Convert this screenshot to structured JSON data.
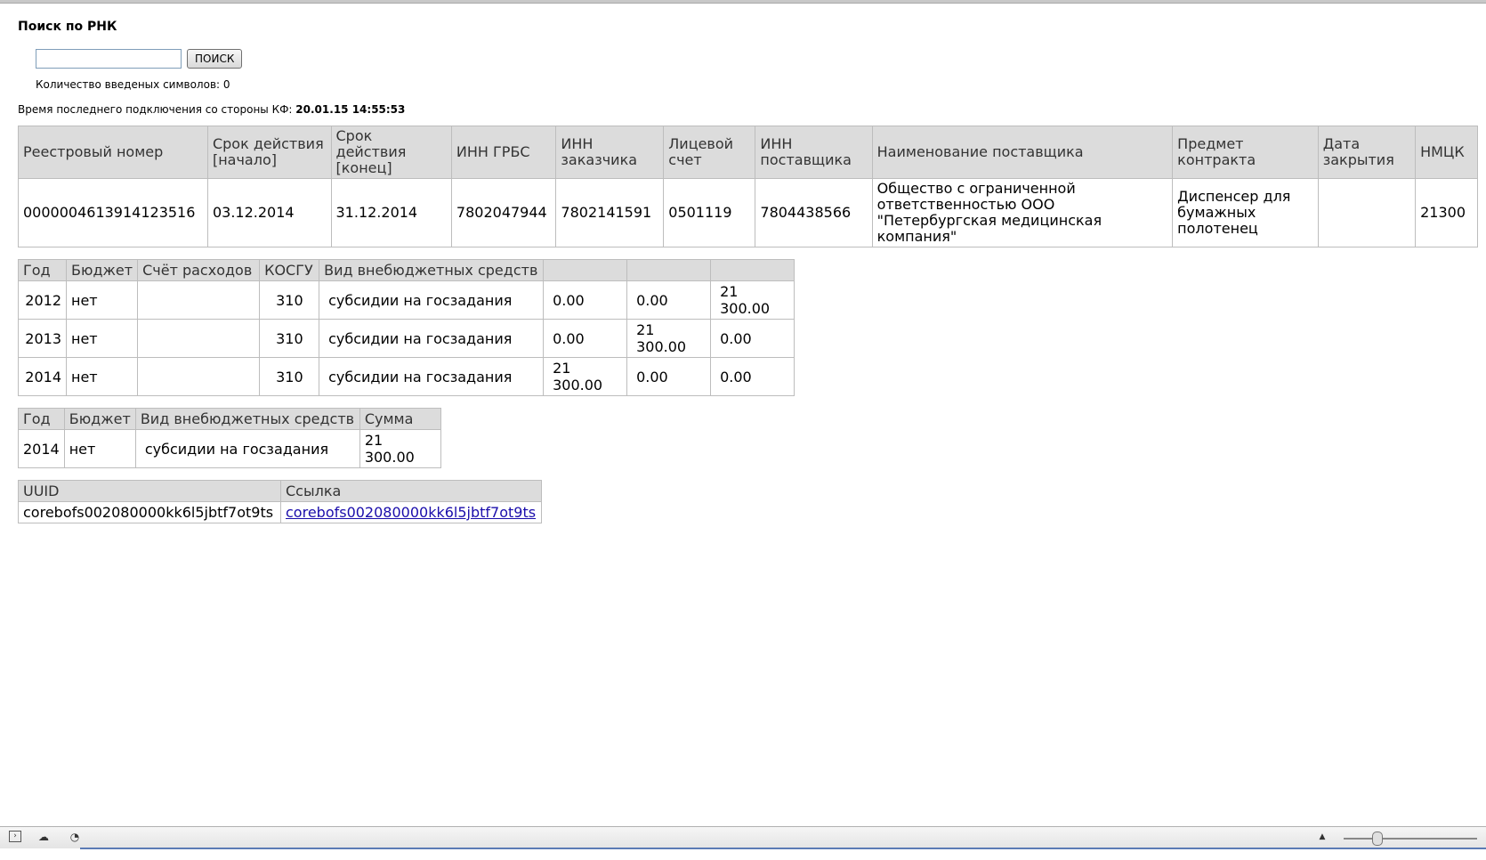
{
  "page": {
    "title": "Поиск по РНК",
    "search": {
      "placeholder": "",
      "value": "",
      "button_label": "ПОИСК"
    },
    "counter_text": "Количество введеных символов: 0",
    "last_connection_label": "Время последнего подключения со стороны КФ:",
    "last_connection_value": "20.01.15 14:55:53"
  },
  "contract_table": {
    "headers": [
      "Реестровый номер",
      "Срок действия [начало]",
      "Срок действия [конец]",
      "ИНН ГРБС",
      "ИНН заказчика",
      "Лицевой счет",
      "ИНН поставщика",
      "Наименование поставщика",
      "Предмет контракта",
      "Дата закрытия",
      "НМЦК"
    ],
    "row": [
      "0000004613914123516",
      "03.12.2014",
      "31.12.2014",
      "7802047944",
      "7802141591",
      "0501119",
      "7804438566",
      "Общество с ограниченной ответственностью ООО \"Петербургская медицинская компания\"",
      "Диспенсер для бумажных полотенец",
      "",
      "21300"
    ]
  },
  "finance_table": {
    "headers": [
      "Год",
      "Бюджет",
      "Счёт расходов",
      "КОСГУ",
      "Вид внебюджетных средств",
      "",
      "",
      ""
    ],
    "rows": [
      [
        "2012",
        "нет",
        "",
        "310",
        "субсидии на госзадания",
        "0.00",
        "0.00",
        "21 300.00"
      ],
      [
        "2013",
        "нет",
        "",
        "310",
        "субсидии на госзадания",
        "0.00",
        "21 300.00",
        "0.00"
      ],
      [
        "2014",
        "нет",
        "",
        "310",
        "субсидии на госзадания",
        "21 300.00",
        "0.00",
        "0.00"
      ]
    ]
  },
  "summary_table": {
    "headers": [
      "Год",
      "Бюджет",
      "Вид внебюджетных средств",
      "Сумма"
    ],
    "row": [
      "2014",
      "нет",
      "субсидии на госзадания",
      "21 300.00"
    ]
  },
  "uuid_table": {
    "headers": [
      "UUID",
      "Ссылка"
    ],
    "row": {
      "uuid": "corebofs002080000kk6l5jbtf7ot9ts",
      "link": "corebofs002080000kk6l5jbtf7ot9ts"
    }
  },
  "statusbar": {
    "icons": [
      "console-icon",
      "cloud-icon",
      "speedometer-icon",
      "arrow-up-icon"
    ]
  }
}
